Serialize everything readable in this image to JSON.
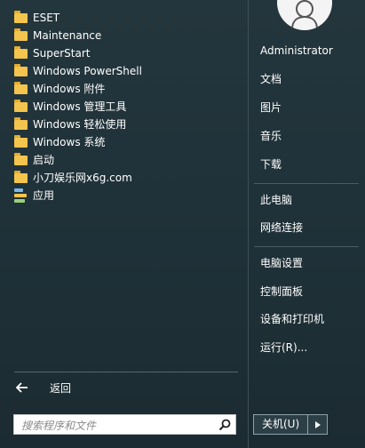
{
  "programs": [
    {
      "label": "ESET",
      "icon": "folder-icon"
    },
    {
      "label": "Maintenance",
      "icon": "folder-icon"
    },
    {
      "label": "SuperStart",
      "icon": "folder-icon"
    },
    {
      "label": "Windows PowerShell",
      "icon": "folder-icon"
    },
    {
      "label": "Windows 附件",
      "icon": "folder-icon"
    },
    {
      "label": "Windows 管理工具",
      "icon": "folder-icon"
    },
    {
      "label": "Windows 轻松使用",
      "icon": "folder-icon"
    },
    {
      "label": "Windows 系统",
      "icon": "folder-icon"
    },
    {
      "label": "启动",
      "icon": "folder-icon"
    },
    {
      "label": "小刀娱乐网x6g.com",
      "icon": "folder-icon"
    },
    {
      "label": "应用",
      "icon": "apps-icon"
    }
  ],
  "back": {
    "label": "返回"
  },
  "search": {
    "placeholder": "搜索程序和文件"
  },
  "user": {
    "name": "Administrator"
  },
  "right_group1": [
    "文档",
    "图片",
    "音乐",
    "下载"
  ],
  "right_group2": [
    "此电脑",
    "网络连接"
  ],
  "right_group3": [
    "电脑设置",
    "控制面板",
    "设备和打印机",
    "运行(R)..."
  ],
  "power": {
    "label": "关机(U)"
  },
  "colors": {
    "background": "#1f3138",
    "folder": "#f3c44e",
    "text": "#ffffff"
  }
}
